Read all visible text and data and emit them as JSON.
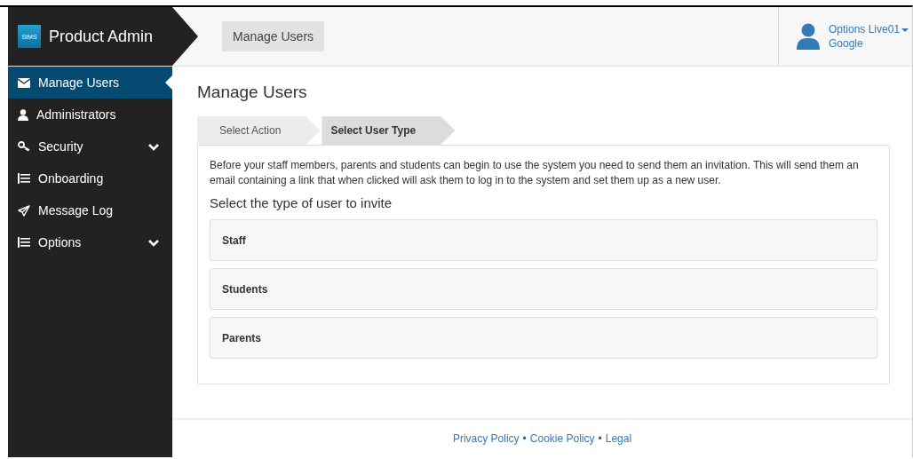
{
  "brand": {
    "logo": "SIMS",
    "title": "Product Admin"
  },
  "header": {
    "page_button": "Manage Users",
    "user": {
      "name": "Options Live01",
      "organisation": "Google"
    }
  },
  "sidebar": {
    "items": [
      {
        "label": "Manage Users",
        "selected": true,
        "kind": "link"
      },
      {
        "label": "Administrators",
        "selected": false,
        "kind": "link"
      },
      {
        "label": "Security",
        "selected": false,
        "kind": "group",
        "expanded": false
      },
      {
        "label": "Onboarding",
        "selected": false,
        "kind": "link"
      },
      {
        "label": "Message Log",
        "selected": false,
        "kind": "link"
      },
      {
        "label": "Options",
        "selected": false,
        "kind": "group",
        "expanded": false
      }
    ]
  },
  "page": {
    "title": "Manage Users",
    "steps": [
      {
        "label": "Select Action",
        "selected": false
      },
      {
        "label": "Select User Type",
        "selected": true
      }
    ],
    "intro": "Before your staff members, parents and students can begin to use the system you need to send them an invitation. This will send them an email containing a link that when clicked will ask them to log in to the system and set them up as a new user.",
    "subtitle": "Select the type of user to invite",
    "user_types": [
      "Staff",
      "Students",
      "Parents"
    ]
  },
  "footer": {
    "links": [
      "Privacy Policy",
      "Cookie Policy",
      "Legal"
    ],
    "separator": "•"
  }
}
